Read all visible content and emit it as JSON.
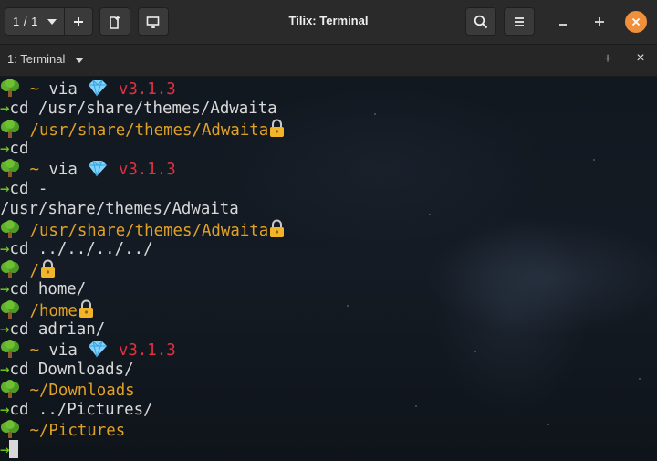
{
  "window": {
    "title": "Tilix: Terminal",
    "session_indicator": "1 / 1",
    "close_color": "#f0903a"
  },
  "icons": {
    "add": "plus-icon",
    "new_session": "new-session-icon",
    "sync": "sync-input-icon",
    "search": "search-icon",
    "menu": "hamburger-menu-icon",
    "minimize": "minimize-icon",
    "maximize": "maximize-icon",
    "close": "close-icon"
  },
  "tab": {
    "title": "1: Terminal",
    "add_label": "+",
    "close_label": "×"
  },
  "terminal": {
    "prompt_arrow": "→",
    "lines": [
      {
        "kind": "status",
        "path": "~",
        "via": "via",
        "version": "v3.1.3"
      },
      {
        "kind": "cmd",
        "text": "cd /usr/share/themes/Adwaita"
      },
      {
        "kind": "locked",
        "path": "/usr/share/themes/Adwaita"
      },
      {
        "kind": "cmd",
        "text": "cd"
      },
      {
        "kind": "status",
        "path": "~",
        "via": "via",
        "version": "v3.1.3"
      },
      {
        "kind": "cmd",
        "text": "cd -"
      },
      {
        "kind": "out",
        "text": "/usr/share/themes/Adwaita"
      },
      {
        "kind": "locked",
        "path": "/usr/share/themes/Adwaita"
      },
      {
        "kind": "cmd",
        "text": "cd ../../../../"
      },
      {
        "kind": "locked",
        "path": "/"
      },
      {
        "kind": "cmd",
        "text": "cd home/"
      },
      {
        "kind": "locked",
        "path": "/home"
      },
      {
        "kind": "cmd",
        "text": "cd adrian/"
      },
      {
        "kind": "status",
        "path": "~",
        "via": "via",
        "version": "v3.1.3"
      },
      {
        "kind": "cmd",
        "text": "cd Downloads/"
      },
      {
        "kind": "dir",
        "path": "~/Downloads"
      },
      {
        "kind": "cmd",
        "text": "cd ../Pictures/"
      },
      {
        "kind": "dir",
        "path": "~/Pictures"
      },
      {
        "kind": "cursor"
      }
    ],
    "colors": {
      "arrow": "#73d216",
      "path": "#e0a226",
      "version": "#e2303f",
      "text": "#d8d8d8"
    }
  }
}
